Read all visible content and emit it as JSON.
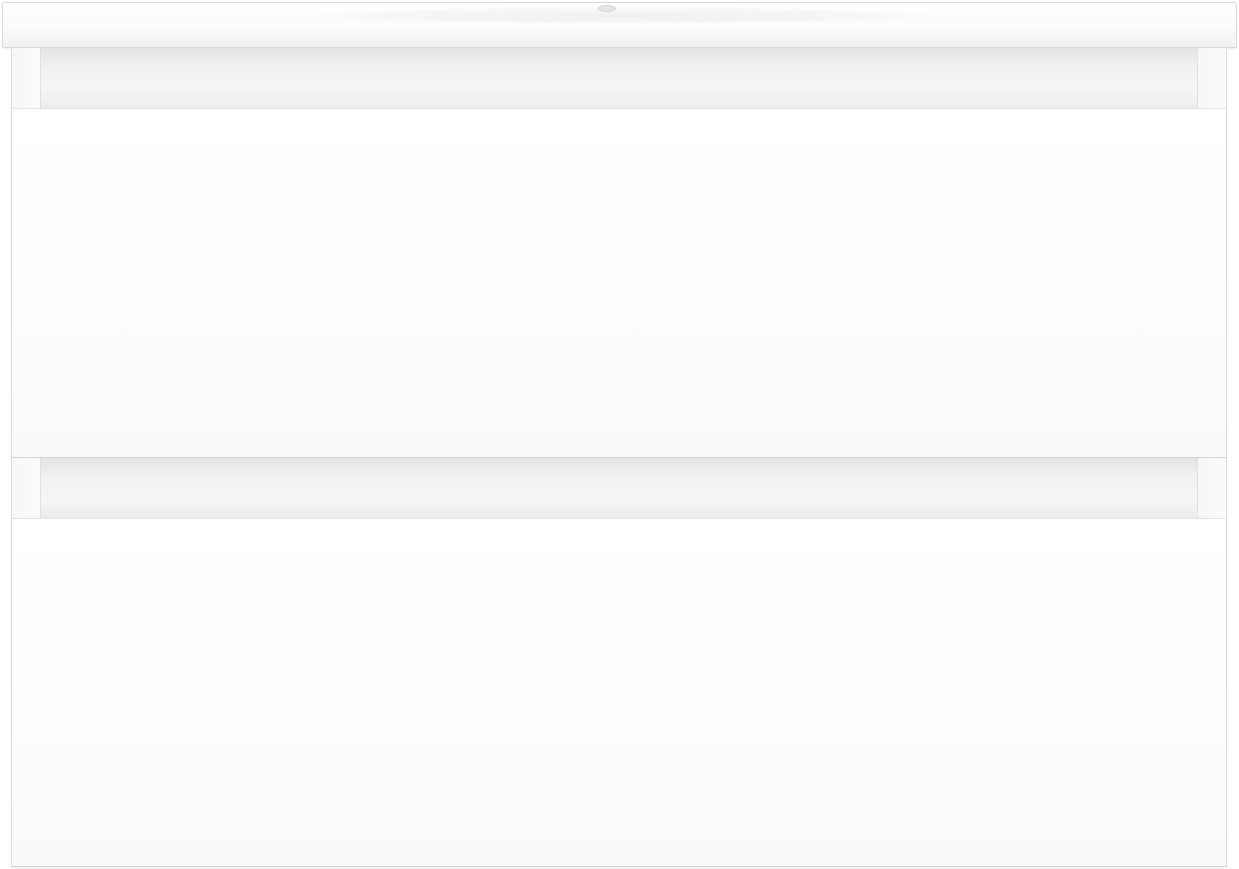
{
  "image": {
    "subject": "vanity-cabinet",
    "colors": {
      "background": "#ffffff",
      "cabinet": "#fafafa",
      "edge": "#d2d2d2"
    },
    "drawers": [
      {
        "id": "upper"
      },
      {
        "id": "lower"
      }
    ]
  }
}
